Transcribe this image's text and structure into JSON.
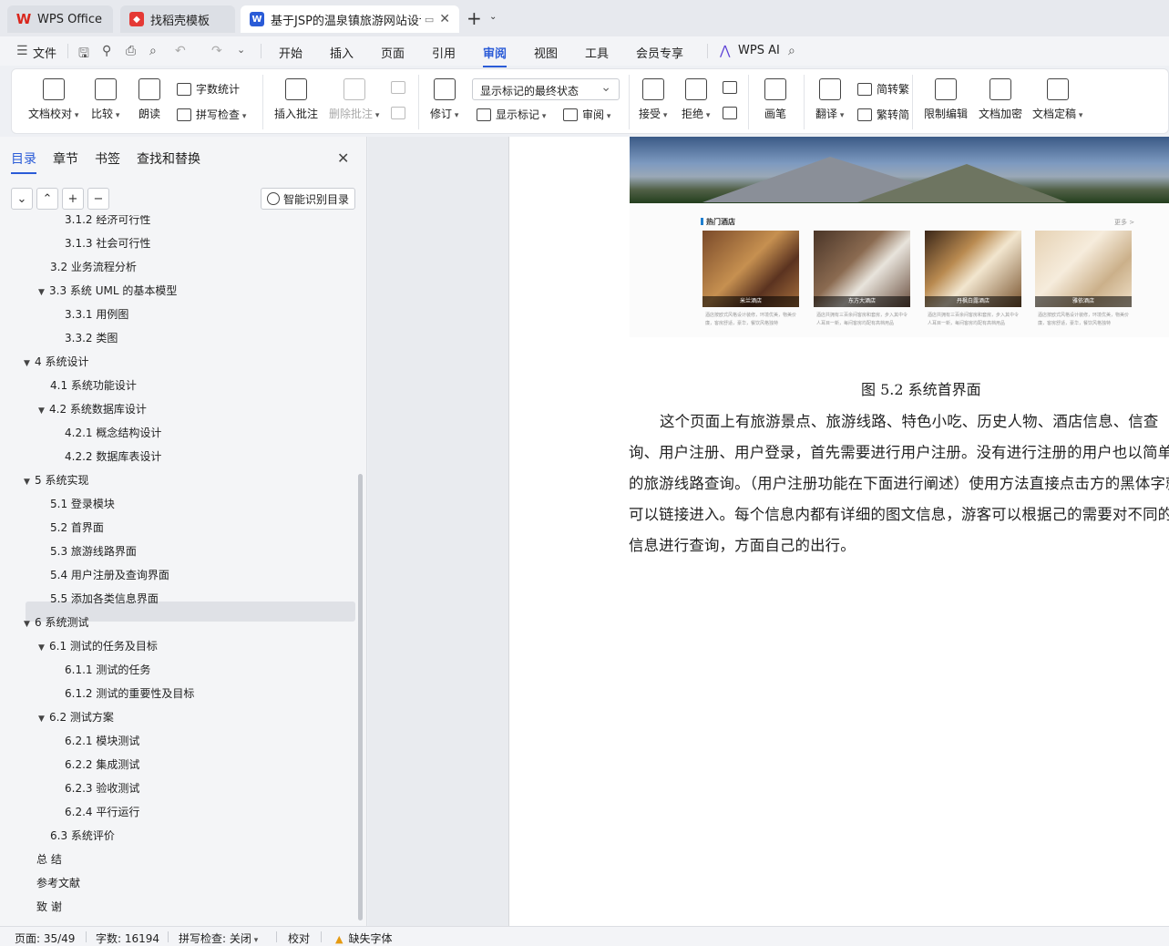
{
  "tabs": [
    {
      "label": "WPS Office",
      "icon": "wps-logo-icon"
    },
    {
      "label": "找稻壳模板",
      "icon": "docer-icon"
    },
    {
      "label": "基于JSP的温泉镇旅游网站设计",
      "icon": "word-doc-icon"
    }
  ],
  "menu": {
    "file": "文件",
    "items": [
      "开始",
      "插入",
      "页面",
      "引用",
      "审阅",
      "视图",
      "工具",
      "会员专享"
    ],
    "active": "审阅",
    "wps_ai": "WPS AI"
  },
  "ribbon": {
    "doc_check": "文档校对",
    "compare": "比较",
    "read_aloud": "朗读",
    "word_count": "字数统计",
    "spell_check": "拼写检查",
    "insert_comment": "插入批注",
    "delete_comment": "删除批注",
    "track": "修订",
    "markup_state": "显示标记的最终状态",
    "show_markup": "显示标记",
    "review": "审阅",
    "accept": "接受",
    "reject": "拒绝",
    "ink": "画笔",
    "translate": "翻译",
    "to_traditional": "简转繁",
    "to_simplified": "繁转简",
    "restrict_edit": "限制编辑",
    "encrypt": "文档加密",
    "finalize": "文档定稿"
  },
  "nav": {
    "tabs": [
      "目录",
      "章节",
      "书签",
      "查找和替换"
    ],
    "active_tab": "目录",
    "smart_toc": "智能识别目录",
    "toc": [
      {
        "text": "3.1.2  经济可行性",
        "level": 3,
        "arrow": ""
      },
      {
        "text": "3.1.3  社会可行性",
        "level": 3,
        "arrow": ""
      },
      {
        "text": "3.2  业务流程分析",
        "level": 2,
        "arrow": ""
      },
      {
        "text": "3.3  系统 UML 的基本模型",
        "level": 2,
        "arrow": "▼"
      },
      {
        "text": "3.3.1  用例图",
        "level": 3,
        "arrow": ""
      },
      {
        "text": "3.3.2  类图",
        "level": 3,
        "arrow": ""
      },
      {
        "text": "4  系统设计",
        "level": 1,
        "arrow": "▼"
      },
      {
        "text": "4.1  系统功能设计",
        "level": 2,
        "arrow": ""
      },
      {
        "text": "4.2  系统数据库设计",
        "level": 2,
        "arrow": "▼"
      },
      {
        "text": "4.2.1  概念结构设计",
        "level": 3,
        "arrow": ""
      },
      {
        "text": "4.2.2  数据库表设计",
        "level": 3,
        "arrow": ""
      },
      {
        "text": "5  系统实现",
        "level": 1,
        "arrow": "▼"
      },
      {
        "text": "5.1 登录模块",
        "level": 2,
        "arrow": ""
      },
      {
        "text": "5.2  首界面",
        "level": 2,
        "arrow": "",
        "selected": true
      },
      {
        "text": "5.3  旅游线路界面",
        "level": 2,
        "arrow": ""
      },
      {
        "text": "5.4  用户注册及查询界面",
        "level": 2,
        "arrow": ""
      },
      {
        "text": "5.5  添加各类信息界面",
        "level": 2,
        "arrow": ""
      },
      {
        "text": "6  系统测试",
        "level": 1,
        "arrow": "▼"
      },
      {
        "text": "6.1 测试的任务及目标",
        "level": 2,
        "arrow": "▼"
      },
      {
        "text": "6.1.1 测试的任务",
        "level": 3,
        "arrow": ""
      },
      {
        "text": "6.1.2 测试的重要性及目标",
        "level": 3,
        "arrow": ""
      },
      {
        "text": "6.2 测试方案",
        "level": 2,
        "arrow": "▼"
      },
      {
        "text": "6.2.1 模块测试",
        "level": 3,
        "arrow": ""
      },
      {
        "text": "6.2.2 集成测试",
        "level": 3,
        "arrow": ""
      },
      {
        "text": "6.2.3 验收测试",
        "level": 3,
        "arrow": ""
      },
      {
        "text": "6.2.4 平行运行",
        "level": 3,
        "arrow": ""
      },
      {
        "text": "6.3 系统评价",
        "level": 2,
        "arrow": ""
      },
      {
        "text": "总    结",
        "level": 0,
        "arrow": ""
      },
      {
        "text": "参考文献",
        "level": 0,
        "arrow": ""
      },
      {
        "text": "致    谢",
        "level": 0,
        "arrow": ""
      }
    ]
  },
  "document": {
    "figure": {
      "section_title": "热门酒店",
      "more": "更多 >",
      "hotels": [
        {
          "name": "米兰酒店",
          "desc": "酒店按欧式风格设计装修，环境优美，物美价廉，客房舒适，豪华，餐饮风格独特"
        },
        {
          "name": "东方大酒店",
          "desc": "酒店共拥有三百余间客房和套房，步入其中令人耳目一新，每间客房均配有高档用品"
        },
        {
          "name": "丹枫白露酒店",
          "desc": "酒店共拥有三百余间客房和套房，步入其中令人耳目一新，每间客房均配有高档用品"
        },
        {
          "name": "雅依酒店",
          "desc": "酒店按欧式风格设计装修，环境优美，物美价廉，客房舒适，豪华，餐饮风格独特"
        }
      ]
    },
    "caption": "图 5.2 系统首界面",
    "paragraph": "这个页面上有旅游景点、旅游线路、特色小吃、历史人物、酒店信息、信查询、用户注册、用户登录，首先需要进行用户注册。没有进行注册的用户也以简单的旅游线路查询。（用户注册功能在下面进行阐述）使用方法直接点击方的黑体字就可以链接进入。每个信息内都有详细的图文信息，游客可以根据己的需要对不同的信息进行查询，方面自己的出行。"
  },
  "status": {
    "page": "页面: 35/49",
    "words": "字数: 16194",
    "spell": "拼写检查: 关闭",
    "proof": "校对",
    "missing_font": "缺失字体"
  }
}
